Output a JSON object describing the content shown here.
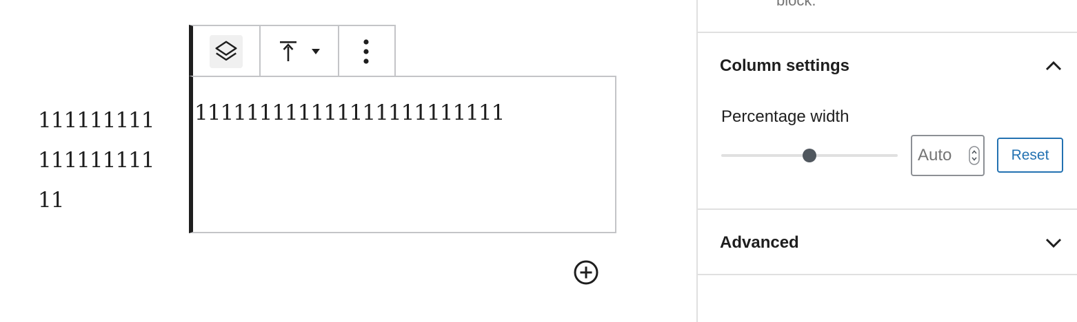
{
  "editor": {
    "left_column_lines": [
      "111111111",
      "111111111",
      "11"
    ],
    "column_text": "111111111111111111111111",
    "toolbar": {
      "select_parent_icon": "layers-icon",
      "vertical_align_icon": "align-top-icon",
      "dropdown_icon": "caret-down-icon",
      "more_options_icon": "vertical-ellipsis-icon"
    },
    "add_block_icon": "plus-circle-icon"
  },
  "sidebar": {
    "previous_panel_text": "block.",
    "column_settings": {
      "title": "Column settings",
      "expanded": true,
      "toggle_icon": "chevron-up-icon",
      "width_label": "Percentage width",
      "slider_value_fraction": 0.5,
      "input_placeholder": "Auto",
      "reset_label": "Reset"
    },
    "advanced": {
      "title": "Advanced",
      "expanded": false,
      "toggle_icon": "chevron-down-icon"
    }
  },
  "colors": {
    "accent": "#2271b1",
    "text": "#1e1e1e",
    "border": "#e0e0e0",
    "thumb": "#50575e"
  }
}
